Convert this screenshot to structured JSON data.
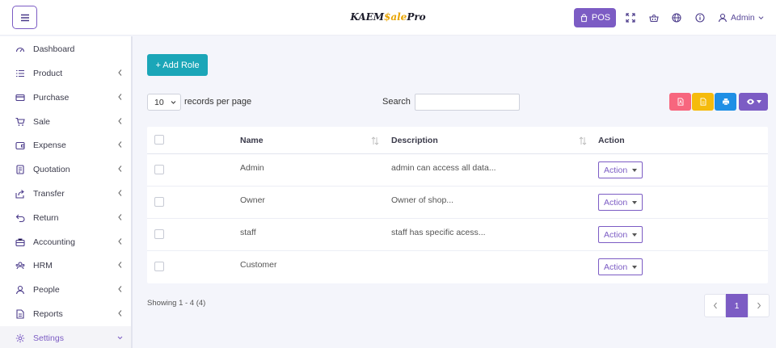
{
  "header": {
    "brand_prefix": "KAEM",
    "brand_accent": "$ale",
    "brand_suffix": "Pro",
    "pos_label": "POS",
    "user_label": "Admin"
  },
  "sidebar": {
    "items": [
      {
        "label": "Dashboard",
        "icon": "dashboard-icon",
        "has_chevron": false
      },
      {
        "label": "Product",
        "icon": "list-icon",
        "has_chevron": true
      },
      {
        "label": "Purchase",
        "icon": "card-icon",
        "has_chevron": true
      },
      {
        "label": "Sale",
        "icon": "cart-icon",
        "has_chevron": true
      },
      {
        "label": "Expense",
        "icon": "wallet-icon",
        "has_chevron": true
      },
      {
        "label": "Quotation",
        "icon": "document-icon",
        "has_chevron": true
      },
      {
        "label": "Transfer",
        "icon": "share-icon",
        "has_chevron": true
      },
      {
        "label": "Return",
        "icon": "return-icon",
        "has_chevron": true
      },
      {
        "label": "Accounting",
        "icon": "briefcase-icon",
        "has_chevron": true
      },
      {
        "label": "HRM",
        "icon": "group-icon",
        "has_chevron": true
      },
      {
        "label": "People",
        "icon": "user-icon",
        "has_chevron": true
      },
      {
        "label": "Reports",
        "icon": "report-icon",
        "has_chevron": true
      },
      {
        "label": "Settings",
        "icon": "gear-icon",
        "has_chevron": true,
        "active": true
      }
    ]
  },
  "toolbar": {
    "add_role_label": "+ Add Role",
    "per_page_value": "10",
    "per_page_label": "records per page",
    "search_label": "Search",
    "search_value": ""
  },
  "table": {
    "columns": [
      "Name",
      "Description",
      "Action"
    ],
    "rows": [
      {
        "name": "Admin",
        "description": "admin can access all data...",
        "action": "Action"
      },
      {
        "name": "Owner",
        "description": "Owner of shop...",
        "action": "Action"
      },
      {
        "name": "staff",
        "description": "staff has specific acess...",
        "action": "Action"
      },
      {
        "name": "Customer",
        "description": "",
        "action": "Action"
      }
    ]
  },
  "footer": {
    "showing_text": "Showing 1 - 4 (4)",
    "current_page": "1"
  },
  "colors": {
    "primary": "#7c5cc4",
    "teal": "#1ba6b8",
    "pdf": "#f7667e",
    "csv": "#f5bb0d",
    "print": "#1f8fe5"
  }
}
